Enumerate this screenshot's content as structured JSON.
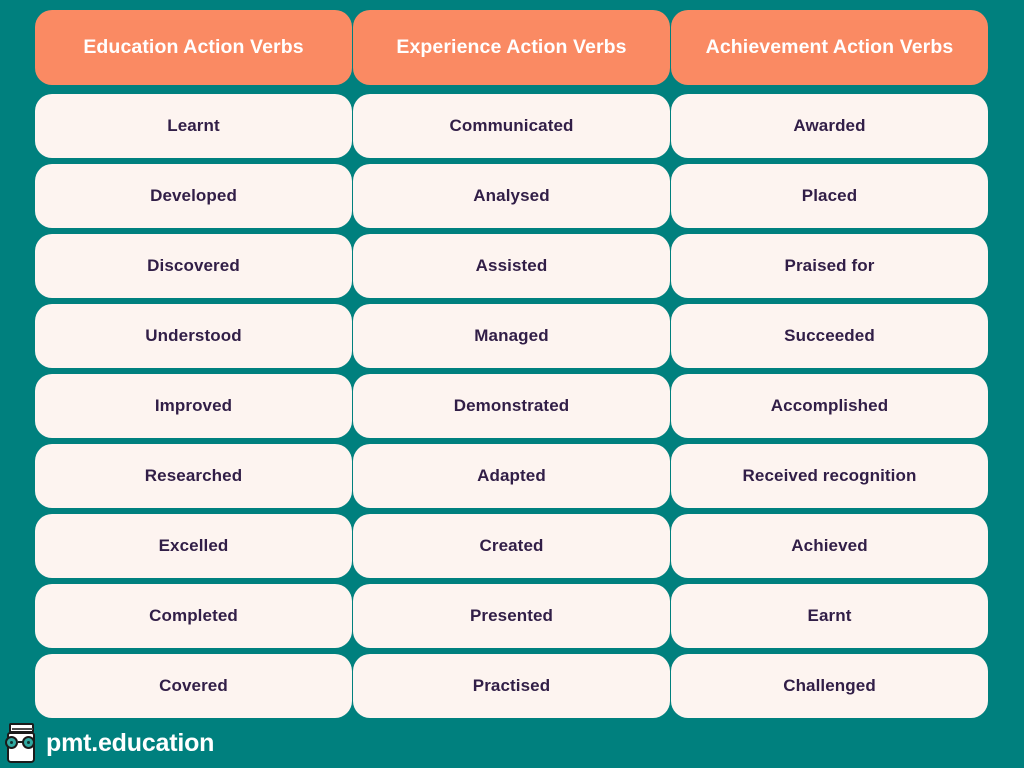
{
  "theme": {
    "background_color": "#00807E",
    "header_card_color": "#FA8A63",
    "verb_card_color": "#FDF4F0",
    "header_text_color": "#FFFFFF",
    "verb_text_color": "#311E47",
    "footer_text_color": "#FFFFFF"
  },
  "columns": [
    {
      "header": "Education Action Verbs",
      "items": [
        "Learnt",
        "Developed",
        "Discovered",
        "Understood",
        "Improved",
        "Researched",
        "Excelled",
        "Completed",
        "Covered"
      ]
    },
    {
      "header": "Experience Action Verbs",
      "items": [
        "Communicated",
        "Analysed",
        "Assisted",
        "Managed",
        "Demonstrated",
        "Adapted",
        "Created",
        "Presented",
        "Practised"
      ]
    },
    {
      "header": "Achievement Action Verbs",
      "items": [
        "Awarded",
        "Placed",
        "Praised for",
        "Succeeded",
        "Accomplished",
        "Received recognition",
        "Achieved",
        "Earnt",
        "Challenged"
      ]
    }
  ],
  "footer": {
    "logo_icon": "pmt-mascot-glasses-book-icon",
    "brand": "pmt.education"
  }
}
